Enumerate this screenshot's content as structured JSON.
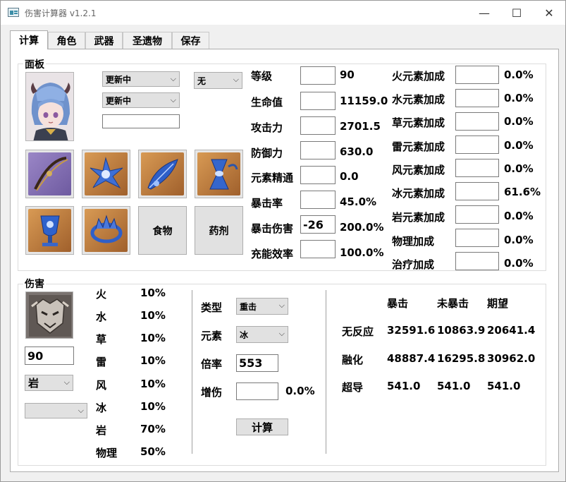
{
  "window": {
    "title": "伤害计算器 v1.2.1",
    "minimize": "—",
    "maximize": "☐",
    "close": "✕"
  },
  "tabs": [
    "计算",
    "角色",
    "武器",
    "圣遗物",
    "保存"
  ],
  "panel": {
    "title": "面板",
    "combo_a": "更新中",
    "combo_b": "更新中",
    "combo_c": "无",
    "text_value": "",
    "food_label": "食物",
    "potion_label": "药剂",
    "stats": [
      {
        "label": "等级",
        "input": "",
        "value": "90"
      },
      {
        "label": "生命值",
        "input": "",
        "value": "11159.0"
      },
      {
        "label": "攻击力",
        "input": "",
        "value": "2701.5"
      },
      {
        "label": "防御力",
        "input": "",
        "value": "630.0"
      },
      {
        "label": "元素精通",
        "input": "",
        "value": "0.0"
      },
      {
        "label": "暴击率",
        "input": "",
        "value": "45.0%"
      },
      {
        "label": "暴击伤害",
        "input": "-26",
        "value": "200.0%"
      },
      {
        "label": "充能效率",
        "input": "",
        "value": "100.0%"
      }
    ],
    "bonuses": [
      {
        "label": "火元素加成",
        "input": "",
        "value": "0.0%"
      },
      {
        "label": "水元素加成",
        "input": "",
        "value": "0.0%"
      },
      {
        "label": "草元素加成",
        "input": "",
        "value": "0.0%"
      },
      {
        "label": "雷元素加成",
        "input": "",
        "value": "0.0%"
      },
      {
        "label": "风元素加成",
        "input": "",
        "value": "0.0%"
      },
      {
        "label": "冰元素加成",
        "input": "",
        "value": "61.6%"
      },
      {
        "label": "岩元素加成",
        "input": "",
        "value": "0.0%"
      },
      {
        "label": "物理加成",
        "input": "",
        "value": "0.0%"
      },
      {
        "label": "治疗加成",
        "input": "",
        "value": "0.0%"
      }
    ]
  },
  "damage": {
    "title": "伤害",
    "enemy_level": "90",
    "enemy_element": "岩",
    "enemy_combo2": "",
    "resistances": [
      {
        "label": "火",
        "value": "10%"
      },
      {
        "label": "水",
        "value": "10%"
      },
      {
        "label": "草",
        "value": "10%"
      },
      {
        "label": "雷",
        "value": "10%"
      },
      {
        "label": "风",
        "value": "10%"
      },
      {
        "label": "冰",
        "value": "10%"
      },
      {
        "label": "岩",
        "value": "70%"
      },
      {
        "label": "物理",
        "value": "50%"
      }
    ],
    "form": {
      "type_label": "类型",
      "type_value": "重击",
      "element_label": "元素",
      "element_value": "冰",
      "multiplier_label": "倍率",
      "multiplier_value": "553",
      "bonus_label": "增伤",
      "bonus_input": "",
      "bonus_value": "0.0%",
      "calc_button": "计算"
    },
    "results": {
      "headers": [
        "暴击",
        "未暴击",
        "期望"
      ],
      "rows": [
        {
          "label": "无反应",
          "values": [
            "32591.6",
            "10863.9",
            "20641.4"
          ]
        },
        {
          "label": "融化",
          "values": [
            "48887.4",
            "16295.8",
            "30962.0"
          ]
        },
        {
          "label": "超导",
          "values": [
            "541.0",
            "541.0",
            "541.0"
          ]
        }
      ]
    }
  },
  "colors": {
    "accent_border": "#adadad",
    "panel_bg": "#ffffff",
    "window_bg": "#f0f0f0"
  }
}
